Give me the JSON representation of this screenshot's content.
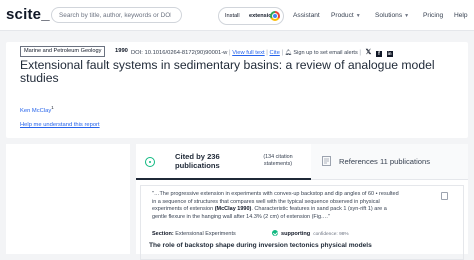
{
  "header": {
    "logo": "scite_",
    "search_placeholder": "Search by title, author, keywords or DOI",
    "install_text": "Install",
    "install_bold": "extension!",
    "nav": {
      "assistant": "Assistant",
      "product": "Product",
      "solutions": "Solutions",
      "pricing": "Pricing",
      "help": "Help"
    }
  },
  "article": {
    "journal": "Marine and Petroleum Geology",
    "year": "1990",
    "doi": "DOI: 10.1016/0264-8172(90)90001-w",
    "view_full_text": "View full text",
    "cite": "Cite",
    "alerts": "Sign up to set email alerts",
    "title": "Extensional fault systems in sedimentary basins: a review of analogue model studies",
    "author": "Ken McClay",
    "author_sup": "1",
    "help_link": "Help me understand this report"
  },
  "tabs": {
    "cited_by": "Cited by 236 publications",
    "citation_statements": "(134 citation statements)",
    "references": "References 11 publications"
  },
  "snippet": {
    "pre": "\"…The progressive extension in experiments with convex-up backstop and dip angles of 60 • resulted in a sequence of structures that compares well with the typical sequence observed in physical experiments of extension ",
    "cite_ref": "(McClay 1990)",
    "post": ". Characteristic features in sand pack 1 (syn-rift 1) are a gentle flexure in the hanging wall after 14.3% (2 cm) of extension (Fig.…\"",
    "section_label": "Section:",
    "section_value": "Extensional Experiments",
    "support_label": "supporting",
    "confidence": "confidence: 98%",
    "next_title": "The role of backstop shape during inversion tectonics physical models"
  },
  "colors": {
    "link": "#2563eb",
    "supporting": "#10b981"
  }
}
